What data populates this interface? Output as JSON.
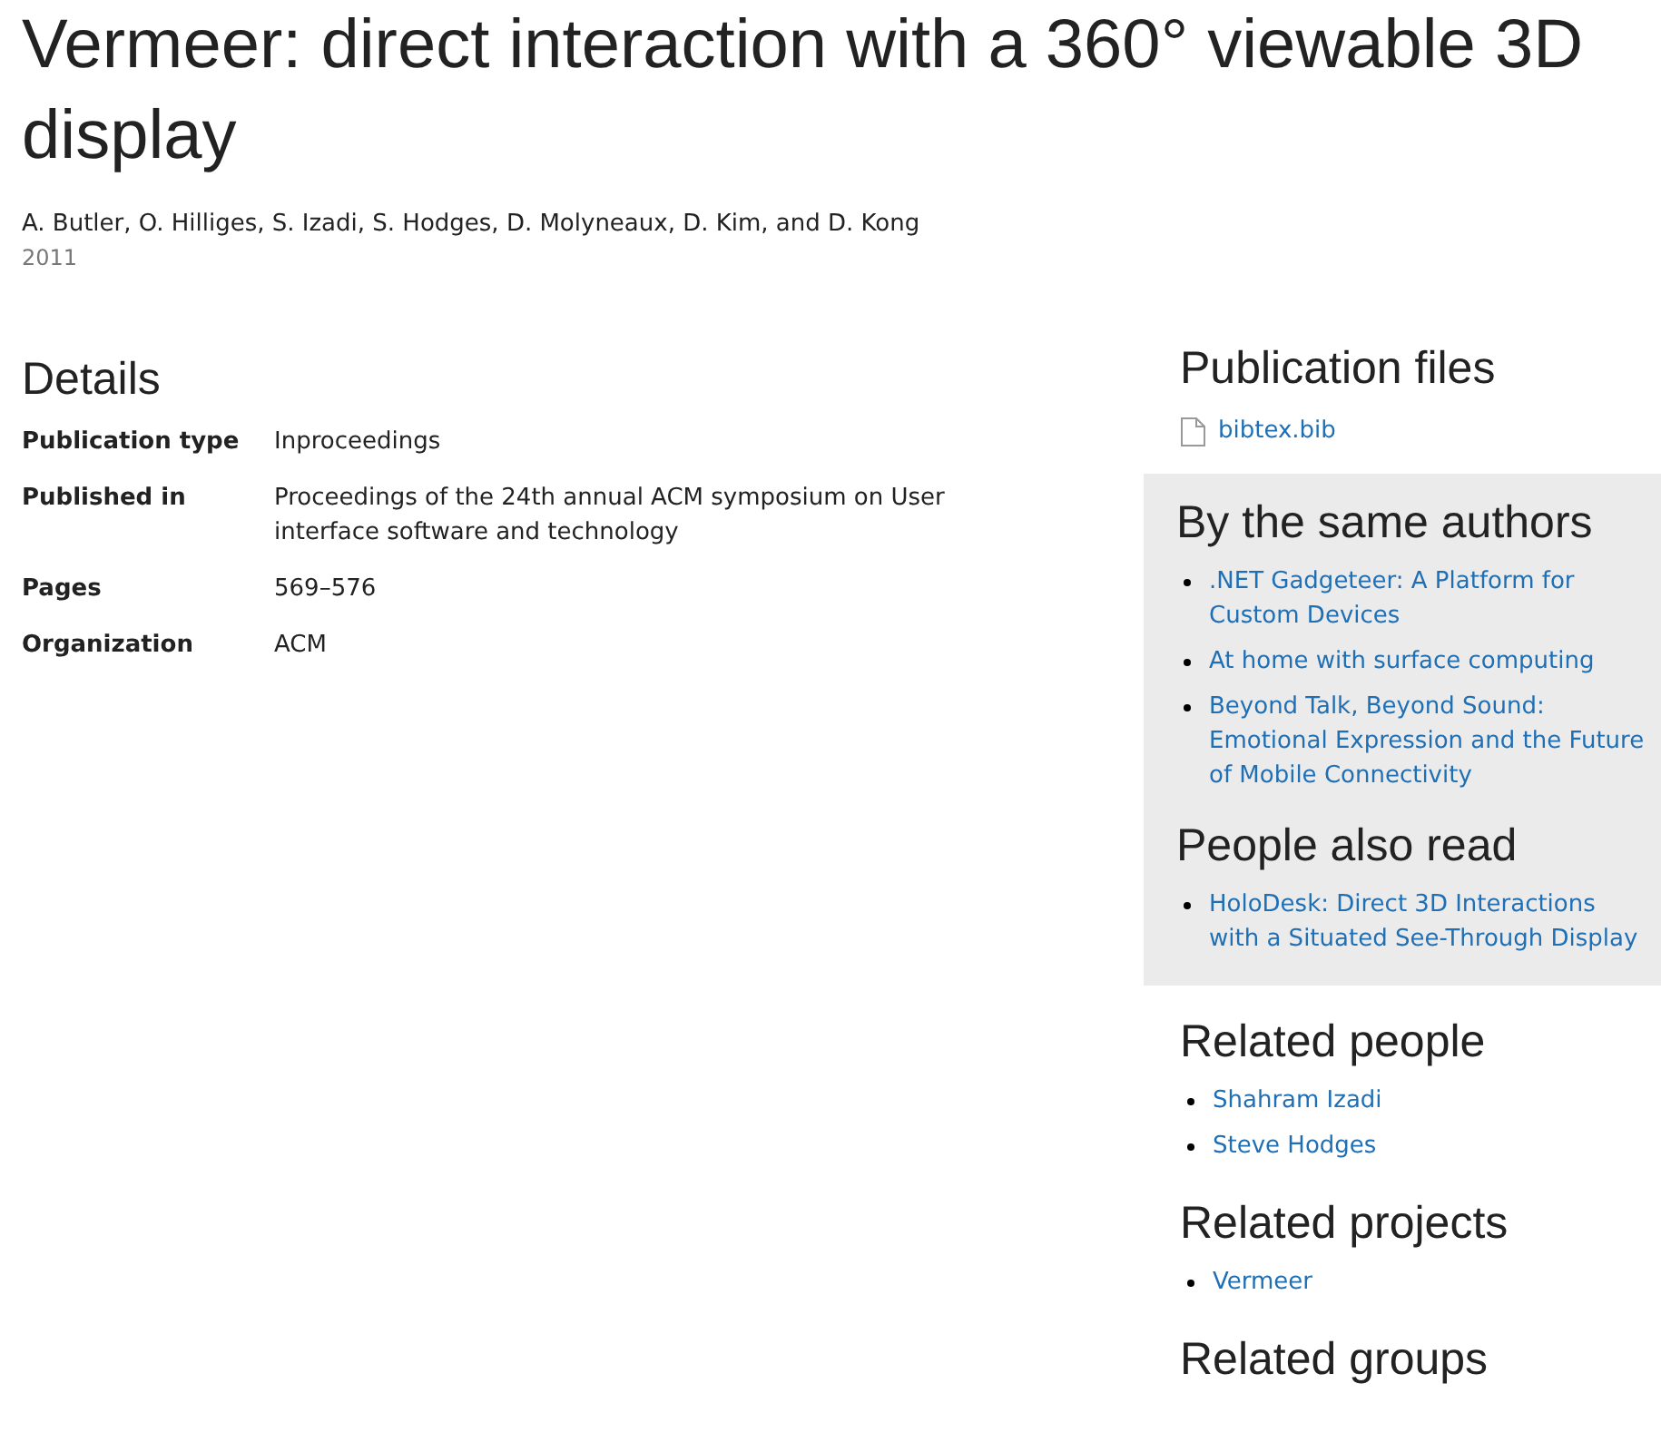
{
  "title": "Vermeer: direct interaction with a 360° viewable 3D display",
  "authors": "A. Butler, O. Hilliges, S. Izadi, S. Hodges, D. Molyneaux, D. Kim, and D. Kong",
  "year": "2011",
  "details": {
    "heading": "Details",
    "rows": [
      {
        "label": "Publication type",
        "value": "Inproceedings"
      },
      {
        "label": "Published in",
        "value": "Proceedings of the 24th annual ACM symposium on User interface software and technology"
      },
      {
        "label": "Pages",
        "value": "569–576"
      },
      {
        "label": "Organization",
        "value": "ACM"
      }
    ]
  },
  "sidebar": [
    {
      "heading": "Publication files",
      "shaded": false,
      "kind": "files",
      "items": [
        "bibtex.bib"
      ]
    },
    {
      "heading": "By the same authors",
      "shaded": true,
      "kind": "list",
      "items": [
        ".NET Gadgeteer: A Platform for Custom Devices",
        "At home with surface computing",
        "Beyond Talk, Beyond Sound: Emotional Expression and the Future of Mobile Connectivity"
      ]
    },
    {
      "heading": "People also read",
      "shaded": true,
      "kind": "list",
      "items": [
        "HoloDesk: Direct 3D Interactions with a Situated See-Through Display"
      ]
    },
    {
      "heading": "Related people",
      "shaded": false,
      "kind": "list",
      "items": [
        "Shahram Izadi",
        "Steve Hodges"
      ]
    },
    {
      "heading": "Related projects",
      "shaded": false,
      "kind": "list",
      "items": [
        "Vermeer"
      ]
    },
    {
      "heading": "Related groups",
      "shaded": false,
      "kind": "list"
    }
  ]
}
